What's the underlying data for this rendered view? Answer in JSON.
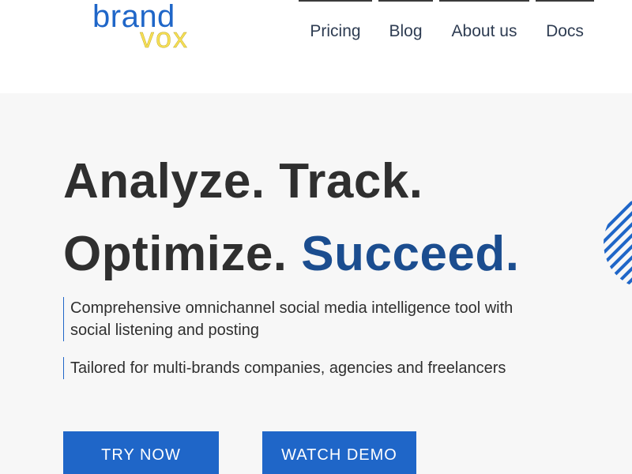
{
  "header": {
    "logo": {
      "brand": "brand",
      "vox": "vox"
    },
    "nav": [
      {
        "label": "Pricing"
      },
      {
        "label": "Blog"
      },
      {
        "label": "About us"
      },
      {
        "label": "Docs"
      }
    ]
  },
  "hero": {
    "headline_line1": "Analyze. Track.",
    "headline_line2_dark": "Optimize.",
    "headline_line2_accent": "Succeed.",
    "description_1": "Comprehensive omnichannel social media intelligence tool with social listening and posting",
    "description_2": "Tailored for multi-brands companies, agencies and freelancers",
    "buttons": {
      "try_now": "TRY NOW",
      "watch_demo": "WATCH DEMO"
    },
    "decoration_icon": "striped-circle-icon"
  },
  "colors": {
    "primary_blue": "#1f66c8",
    "accent_dark_blue": "#1b4d8f",
    "logo_yellow": "#f6df55",
    "text_dark": "#2f2f2f",
    "hero_bg": "#f7f7f7"
  }
}
